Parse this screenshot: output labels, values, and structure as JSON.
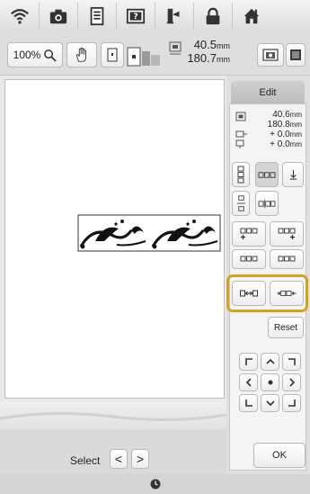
{
  "top_icons": [
    "wifi-icon",
    "camera-icon",
    "document-icon",
    "help-icon",
    "thread-spool-icon",
    "lock-icon",
    "home-icon"
  ],
  "toolbar": {
    "zoom_label": "100%",
    "size_width": "40.5",
    "size_height": "180.7",
    "unit": "mm"
  },
  "panel": {
    "tab_label": "Edit",
    "info": {
      "width": "40.6",
      "height": "180.8",
      "offset_x": "+ 0.0",
      "offset_y": "+ 0.0",
      "unit": "mm"
    },
    "reset_label": "Reset",
    "ok_label": "OK"
  },
  "bottom": {
    "select_label": "Select",
    "prev_glyph": "<",
    "next_glyph": ">"
  },
  "colors": {
    "highlight": "#d1a41f"
  }
}
